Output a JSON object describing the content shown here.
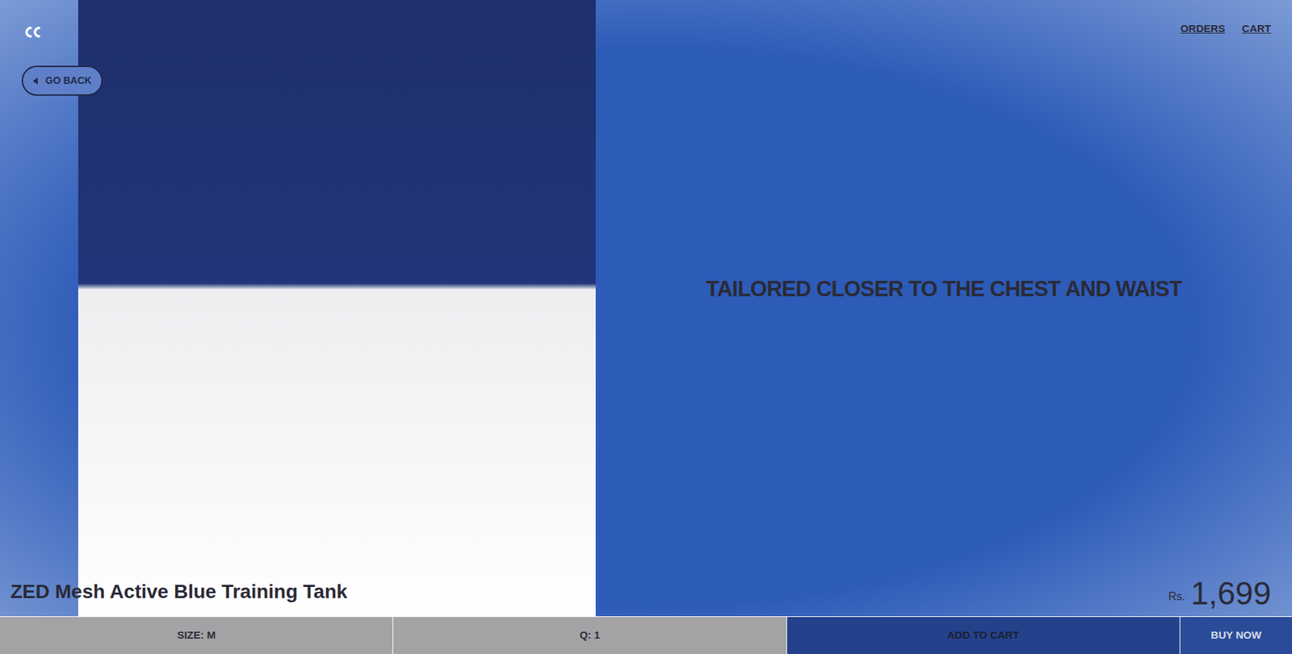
{
  "nav": [
    {
      "label": "ORDERS"
    },
    {
      "label": "CART"
    }
  ],
  "back_button": {
    "label": "GO BACK"
  },
  "headline": "TAILORED CLOSER TO THE CHEST AND WAIST",
  "product": {
    "title": "ZED Mesh Active Blue Training Tank",
    "currency": "Rs.",
    "price": "1,699"
  },
  "actions": [
    {
      "label": "SIZE: M",
      "kind": "option"
    },
    {
      "label": "Q: 1",
      "kind": "option"
    },
    {
      "label": "ADD TO CART",
      "kind": "primary"
    },
    {
      "label": "BUY NOW",
      "kind": "secondary"
    }
  ]
}
